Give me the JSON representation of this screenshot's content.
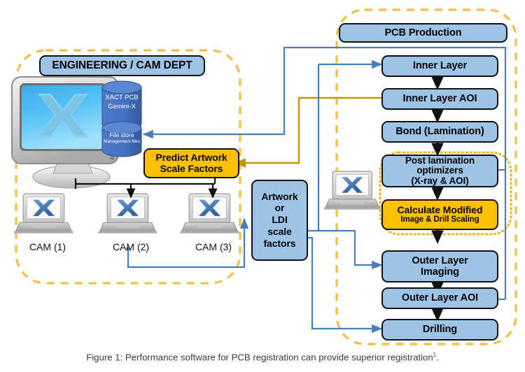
{
  "figure": {
    "caption_text": "Figure 1: Performance software for PCB registration can provide superior registration",
    "caption_superscript": "1",
    "caption_period": "."
  },
  "colors": {
    "node_blue": "#9dc3e6",
    "node_amber": "#ffc000",
    "border_dark": "#111111",
    "group_dashed_yellow": "#f0c042",
    "group_dotted_yellow": "#f0b429",
    "arrow_blue": "#4a7ebb",
    "arrow_amber": "#c79300",
    "arrow_black": "#111111",
    "db_cylinder": "#4472c4",
    "caption_gray": "#3c3c3c"
  },
  "groups": {
    "engineering": {
      "label": "ENGINEERING / CAM DEPT",
      "style": "dashed-yellow-rounded"
    },
    "pcb_production": {
      "label": "PCB Production",
      "style": "dashed-yellow-rounded"
    },
    "optimizer_subgroup": {
      "style": "dotted-yellow-rounded"
    }
  },
  "engineering_dept": {
    "title": "ENGINEERING / CAM DEPT",
    "server": {
      "icon": "crt-monitor-and-server-tower-icon",
      "databases": [
        {
          "name": "xact-pcb-database",
          "line1": "XACT PCB",
          "line2": "Gemini-X"
        },
        {
          "name": "file-store-database",
          "line1": "File store",
          "line2": "Management files"
        }
      ]
    },
    "predict_box": {
      "line1": "Predict Artwork",
      "line2": "Scale Factors",
      "color": "amber"
    },
    "cam_stations": [
      {
        "icon": "laptop-icon",
        "label": "CAM (1)"
      },
      {
        "icon": "laptop-icon",
        "label": "CAM (2)"
      },
      {
        "icon": "laptop-icon",
        "label": "CAM (3)"
      }
    ]
  },
  "artwork_box": {
    "lines": [
      "Artwork",
      "or",
      "LDI",
      "scale",
      "factors"
    ],
    "color": "blue"
  },
  "shopfloor_laptop": {
    "icon": "laptop-icon",
    "label": ""
  },
  "production_flow": {
    "header": "PCB Production",
    "steps": [
      {
        "id": "inner-layer",
        "lines": [
          "Inner Layer"
        ],
        "color": "blue"
      },
      {
        "id": "inner-layer-aoi",
        "lines": [
          "Inner Layer AOI"
        ],
        "color": "blue"
      },
      {
        "id": "bond-lamination",
        "lines": [
          "Bond (Lamination)"
        ],
        "color": "blue"
      },
      {
        "id": "post-lamination",
        "lines": [
          "Post lamination",
          "optimizers",
          "(X-ray & AOI)"
        ],
        "color": "blue"
      },
      {
        "id": "calculate-modified",
        "lines": [
          "Calculate Modified",
          "Image & Drill Scaling"
        ],
        "color": "amber"
      },
      {
        "id": "outer-layer-imaging",
        "lines": [
          "Outer Layer",
          "Imaging"
        ],
        "color": "blue"
      },
      {
        "id": "outer-layer-aoi",
        "lines": [
          "Outer Layer AOI"
        ],
        "color": "blue"
      },
      {
        "id": "drilling",
        "lines": [
          "Drilling"
        ],
        "color": "blue"
      }
    ]
  }
}
